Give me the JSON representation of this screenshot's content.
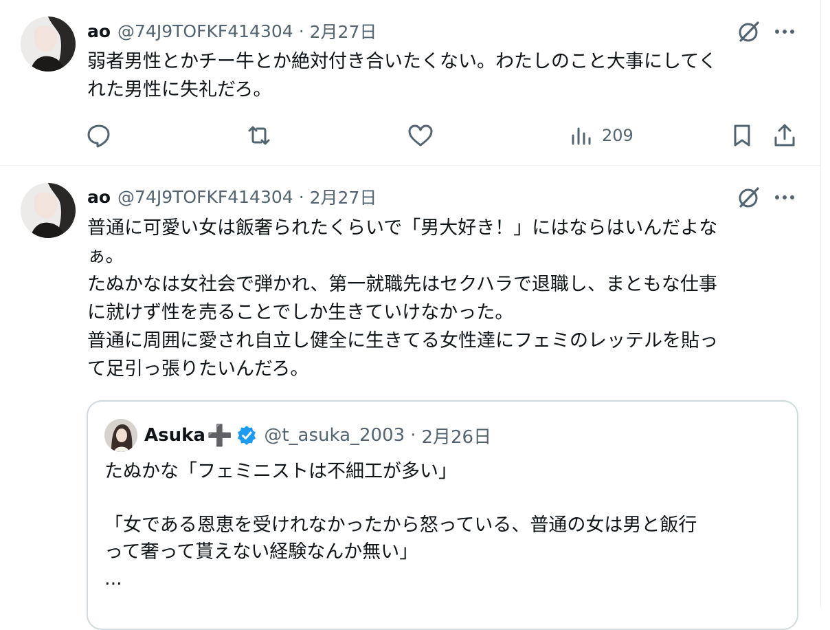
{
  "tweets": [
    {
      "name": "ao",
      "handle": "@74J9TOFKF414304",
      "date": "2月27日",
      "lines": [
        "弱者男性とかチー牛とか絶対付き合いたくない。わたしのこと大事にしてく",
        "れた男性に失礼だろ。"
      ],
      "views": "209"
    },
    {
      "name": "ao",
      "handle": "@74J9TOFKF414304",
      "date": "2月27日",
      "lines": [
        "普通に可愛い女は飯奢られたくらいで「男大好き！」にはならはいんだよな",
        "ぁ。",
        "たぬかなは女社会で弾かれ、第一就職先はセクハラで退職し、まともな仕事",
        "に就けず性を売ることでしか生きていけなかった。",
        "普通に周囲に愛され自立し健全に生きてる女性達にフェミのレッテルを貼っ",
        "て足引っ張りたいんだろ。"
      ]
    }
  ],
  "quote": {
    "name": "Asuka",
    "name_suffix": "➕",
    "handle": "@t_asuka_2003",
    "date": "2月26日",
    "lines": [
      "たぬかな「フェミニストは不細工が多い」",
      "",
      "「女である恩恵を受けれなかったから怒っている、普通の女は男と飯行",
      "って奢って貰えない経験なんか無い」",
      "..."
    ]
  },
  "separator": "·",
  "colors": {
    "text": "#0f1419",
    "secondary": "#536471",
    "border": "#cfd9de",
    "divider": "#eff3f4",
    "verified": "#1d9bf0"
  },
  "icons": {
    "reply": "reply-icon",
    "retweet": "retweet-icon",
    "like": "heart-icon",
    "views": "views-icon",
    "bookmark": "bookmark-icon",
    "share": "share-icon",
    "grok": "grok-icon",
    "more": "more-icon",
    "verified": "verified-badge-icon"
  }
}
